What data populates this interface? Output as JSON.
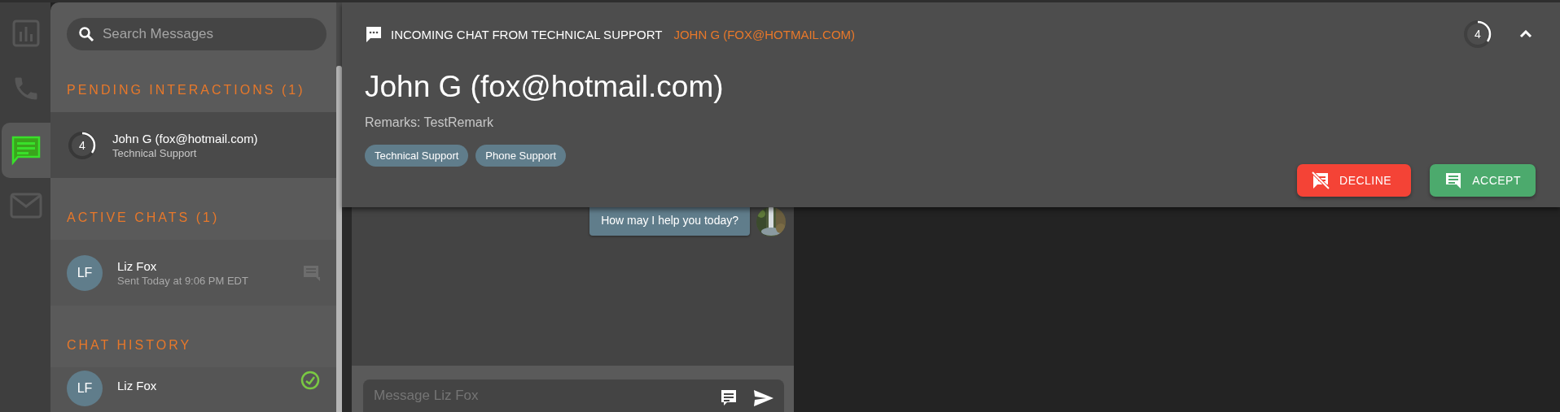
{
  "rail": [
    {
      "kind": "stats",
      "selected": false
    },
    {
      "kind": "phone",
      "selected": false
    },
    {
      "kind": "chat",
      "selected": true
    },
    {
      "kind": "mail",
      "selected": false
    }
  ],
  "search": {
    "placeholder": "Search Messages"
  },
  "sections": [
    {
      "title": "PENDING INTERACTIONS (1)",
      "items": [
        {
          "kind": "timer",
          "count": "4",
          "level": 0.35,
          "name": "John G (fox@hotmail.com)",
          "subtitle": "Technical Support"
        }
      ]
    },
    {
      "title": "ACTIVE CHATS (1)",
      "items": [
        {
          "kind": "chat",
          "initials": "LF",
          "name": "Liz Fox",
          "subtitle": "Sent Today at 9:06 PM EDT"
        }
      ]
    },
    {
      "title": "CHAT HISTORY",
      "items": [
        {
          "kind": "history",
          "initials": "LF",
          "name": "Liz Fox"
        }
      ]
    }
  ],
  "messages": [
    {
      "text": "How may I help you today?"
    }
  ],
  "composer": {
    "placeholder": "Message Liz Fox"
  },
  "incoming": {
    "title": "INCOMING CHAT FROM TECHNICAL SUPPORT",
    "from": "JOHN G (FOX@HOTMAIL.COM)",
    "timer": {
      "count": "4",
      "level": 0.35
    },
    "name": "John G (fox@hotmail.com)",
    "remarks": "Remarks: TestRemark",
    "tags": [
      "Technical Support",
      "Phone Support"
    ],
    "buttons": [
      {
        "kind": "decline",
        "label": "DECLINE"
      },
      {
        "kind": "accept",
        "label": "ACCEPT"
      }
    ]
  }
}
